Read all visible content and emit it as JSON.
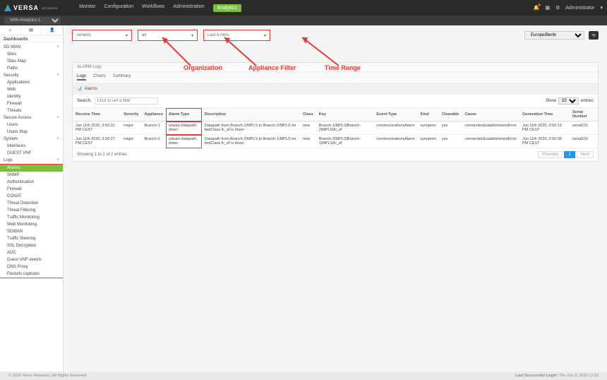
{
  "brand": {
    "name": "VERSA",
    "sub": "NETWORKS"
  },
  "topnav": {
    "items": [
      "Monitor",
      "Configuration",
      "Workflows",
      "Administration",
      "Analytics"
    ],
    "active": 4
  },
  "topbar": {
    "user": "Administrator",
    "tenant": "VAN-Analytics-1"
  },
  "sidebar": {
    "title_dashboards": "Dashboards",
    "groups": [
      {
        "label": "SD-WAN",
        "items": [
          "Sites",
          "Sites Map",
          "Paths"
        ]
      },
      {
        "label": "Security",
        "items": [
          "Applications",
          "Web",
          "Identity",
          "Firewall",
          "Threats"
        ]
      },
      {
        "label": "Secure Access",
        "items": [
          "Users",
          "Users Map"
        ]
      },
      {
        "label": "System",
        "items": [
          "Interfaces",
          "GUEST VNF"
        ]
      }
    ],
    "logs_label": "Logs",
    "logs": [
      "Alarms",
      "SNMP",
      "Authentication",
      "Firewall",
      "CGNAT",
      "Threat Detection",
      "Threat Filtering",
      "Traffic Monitoring",
      "Web Monitoring",
      "SDWAN",
      "Traffic Steering",
      "SSL Decryption",
      "ADC",
      "Guest VNF events",
      "DNS Proxy",
      "Packets captures"
    ],
    "logs_active": 0
  },
  "filters": {
    "org": "Tenant1",
    "appliance": "all",
    "timerange": "Last 5 mins",
    "timezone": "Europe/Berlin"
  },
  "labels": {
    "org": "Organization",
    "appliance": "Appliance Filter",
    "time": "Time Range"
  },
  "panel": {
    "title": "ALARM Logs",
    "tabs": [
      "Logs",
      "Charts",
      "Summary"
    ],
    "tabs_active": 0,
    "subtitle": "Alarms",
    "search_label": "Search:",
    "search_placeholder": "Click to set a filter",
    "show_label": "Show",
    "show_value": "10",
    "entries_label": "entries"
  },
  "table": {
    "columns": [
      "Receive Time",
      "Severity",
      "Appliance",
      "Alarm Type",
      "Description",
      "Class",
      "Key",
      "Event Type",
      "Kind",
      "Clearable",
      "Cause",
      "Generation Time",
      "Serial Number"
    ],
    "hl_col": 3,
    "rows": [
      {
        "cells": [
          "Jun 11th 2020, 3:50:31 PM CEST",
          "major",
          "Branch-1",
          "sdwan-datapath-down",
          "Datapath from Branch-1/MPLS to Branch-2/MPLS for fwdClass fc_ef is down",
          "new",
          "Branch-1|MPLS|Branch-2|MPLS|fc_ef",
          "communicationsAlarm",
          "symptom",
          "yes",
          "connectionEstablishmentError",
          "Jun 11th 2020, 3:50:13 PM CEST",
          "serial101"
        ]
      },
      {
        "cells": [
          "Jun 11th 2020, 3:50:27 PM CEST",
          "major",
          "Branch-2",
          "sdwan-datapath-down",
          "Datapath from Branch-2/MPLS to Branch-1/MPLS for fwdClass fc_ef is down",
          "new",
          "Branch-2|MPLS|Branch-1|MPLS|fc_ef",
          "communicationsAlarm",
          "symptom",
          "yes",
          "connectionEstablishmentError",
          "Jun 11th 2020, 3:50:09 PM CEST",
          "serial102"
        ]
      }
    ],
    "footer_text": "Showing 1 to 2 of 2 entries",
    "pager": {
      "prev": "Previous",
      "page": "1",
      "next": "Next"
    }
  },
  "footer": {
    "copyright": "© 2020 Versa Networks | All Rights Reserved",
    "last_login_label": "Last Successful Login:",
    "last_login_value": "Thu Jun 11 2020 12:12"
  }
}
